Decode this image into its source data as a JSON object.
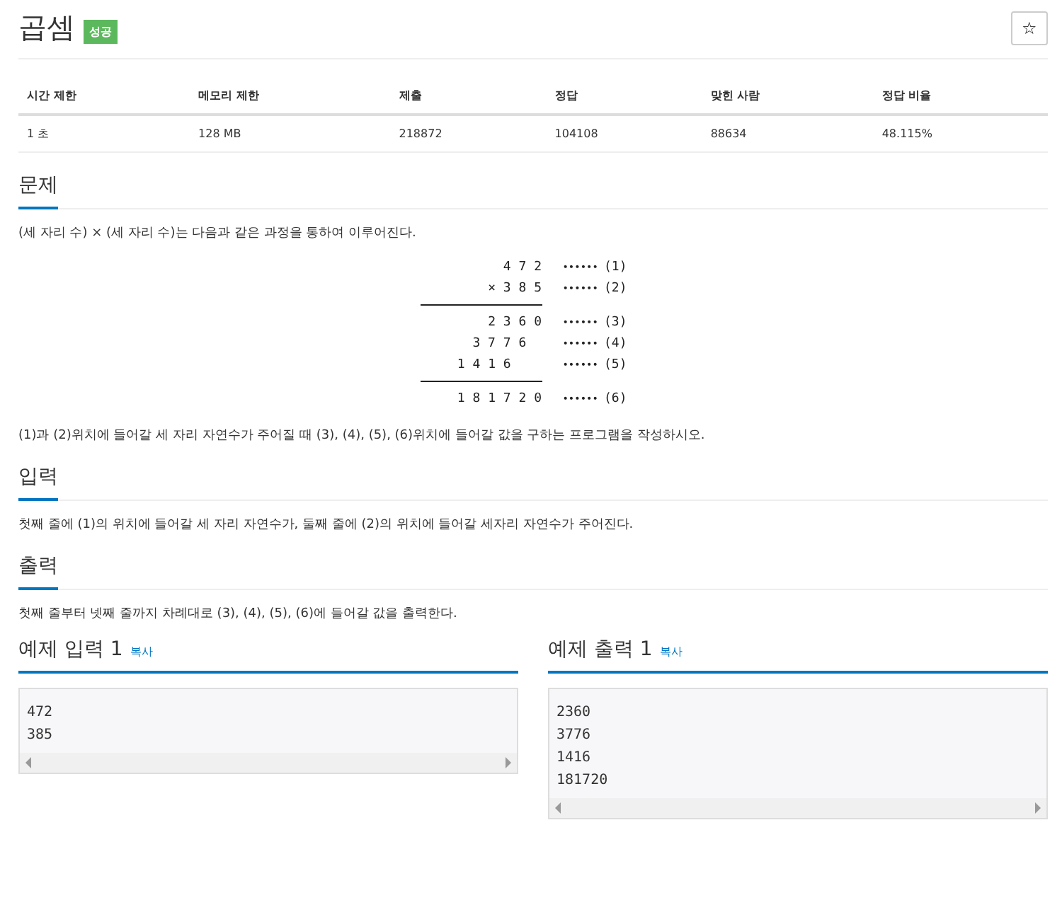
{
  "problem": {
    "title": "곱셈",
    "badge": "성공",
    "star": "☆"
  },
  "info_table": {
    "columns": [
      "시간 제한",
      "메모리 제한",
      "제출",
      "정답",
      "맞힌 사람",
      "정답 비율"
    ],
    "row": [
      "1 초",
      "128 MB",
      "218872",
      "104108",
      "88634",
      "48.115%"
    ]
  },
  "sections": [
    {
      "heading": "문제",
      "paragraphs": [
        "(세 자리 수) × (세 자리 수)는 다음과 같은 과정을 통하여 이루어진다.",
        "(1)과 (2)위치에 들어갈 세 자리 자연수가 주어질 때 (3), (4), (5), (6)위치에 들어갈 값을 구하는 프로그램을 작성하시오."
      ],
      "figure": [
        {
          "kind": "line",
          "digits": "4 7 2",
          "marks": "••••••",
          "label": "(1)"
        },
        {
          "kind": "line",
          "digits": "× 3 8 5",
          "marks": "••••••",
          "label": "(2)"
        },
        {
          "kind": "rule"
        },
        {
          "kind": "line",
          "digits": "2 3 6 0",
          "marks": "••••••",
          "label": "(3)"
        },
        {
          "kind": "line",
          "digits": "3 7 7 6  ",
          "marks": "••••••",
          "label": "(4)"
        },
        {
          "kind": "line",
          "digits": "1 4 1 6    ",
          "marks": "••••••",
          "label": "(5)"
        },
        {
          "kind": "rule"
        },
        {
          "kind": "line",
          "digits": "1 8 1 7 2 0",
          "marks": "••••••",
          "label": "(6)"
        }
      ]
    },
    {
      "heading": "입력",
      "paragraphs": [
        "첫째 줄에 (1)의 위치에 들어갈 세 자리 자연수가, 둘째 줄에 (2)의 위치에 들어갈 세자리 자연수가 주어진다."
      ]
    },
    {
      "heading": "출력",
      "paragraphs": [
        "첫째 줄부터 넷째 줄까지 차례대로 (3), (4), (5), (6)에 들어갈 값을 출력한다."
      ]
    }
  ],
  "samples": [
    {
      "heading": "예제 입력 1",
      "copy": "복사",
      "lines": [
        "472",
        "385"
      ]
    },
    {
      "heading": "예제 출력 1",
      "copy": "복사",
      "lines": [
        "2360",
        "3776",
        "1416",
        "181720"
      ]
    }
  ]
}
